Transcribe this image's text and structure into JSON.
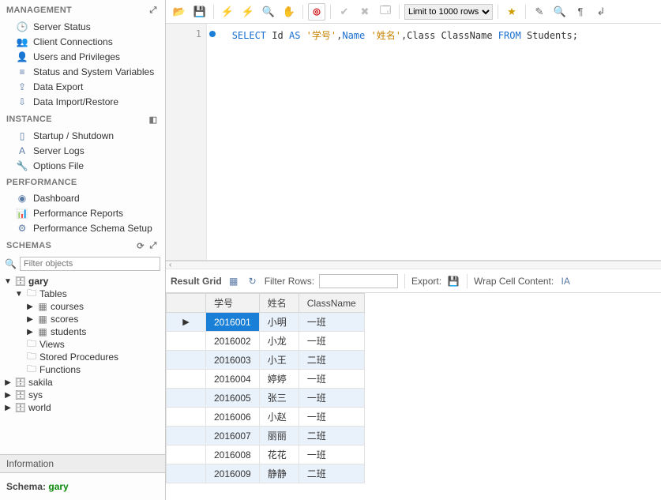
{
  "sidebar": {
    "management": {
      "header": "MANAGEMENT",
      "items": [
        {
          "icon": "🕒",
          "label": "Server Status"
        },
        {
          "icon": "👥",
          "label": "Client Connections"
        },
        {
          "icon": "👤",
          "label": "Users and Privileges"
        },
        {
          "icon": "≡",
          "label": "Status and System Variables"
        },
        {
          "icon": "⇪",
          "label": "Data Export"
        },
        {
          "icon": "⇩",
          "label": "Data Import/Restore"
        }
      ]
    },
    "instance": {
      "header": "INSTANCE",
      "items": [
        {
          "icon": "▯",
          "label": "Startup / Shutdown"
        },
        {
          "icon": "A",
          "label": "Server Logs"
        },
        {
          "icon": "🔧",
          "label": "Options File"
        }
      ]
    },
    "performance": {
      "header": "PERFORMANCE",
      "items": [
        {
          "icon": "◉",
          "label": "Dashboard"
        },
        {
          "icon": "📊",
          "label": "Performance Reports"
        },
        {
          "icon": "⚙",
          "label": "Performance Schema Setup"
        }
      ]
    },
    "schemas": {
      "header": "SCHEMAS",
      "filter_placeholder": "Filter objects",
      "active": "gary",
      "folders": [
        "Tables",
        "Views",
        "Stored Procedures",
        "Functions"
      ],
      "tables": [
        "courses",
        "scores",
        "students"
      ],
      "other_schemas": [
        "sakila",
        "sys",
        "world"
      ]
    },
    "info": {
      "header": "Information",
      "label": "Schema:",
      "value": "gary"
    }
  },
  "toolbar": {
    "limit_label": "Limit to 1000 rows"
  },
  "editor": {
    "line_number": "1",
    "sql": {
      "k_select": "SELECT",
      "id": "Id",
      "k_as": "AS",
      "s1": "'学号'",
      "c1": ",",
      "name": "Name",
      "s2": "'姓名'",
      "c2": ",",
      "class": "Class",
      "classname": "ClassName",
      "k_from": "FROM",
      "tbl": "Students;"
    }
  },
  "results": {
    "grid_label": "Result Grid",
    "filter_label": "Filter Rows:",
    "filter_value": "",
    "export_label": "Export:",
    "wrap_label": "Wrap Cell Content:",
    "columns": [
      "学号",
      "姓名",
      "ClassName"
    ],
    "rows": [
      [
        "2016001",
        "小明",
        "一班"
      ],
      [
        "2016002",
        "小龙",
        "一班"
      ],
      [
        "2016003",
        "小王",
        "二班"
      ],
      [
        "2016004",
        "婷婷",
        "一班"
      ],
      [
        "2016005",
        "张三",
        "一班"
      ],
      [
        "2016006",
        "小赵",
        "一班"
      ],
      [
        "2016007",
        "丽丽",
        "二班"
      ],
      [
        "2016008",
        "花花",
        "一班"
      ],
      [
        "2016009",
        "静静",
        "二班"
      ]
    ]
  }
}
